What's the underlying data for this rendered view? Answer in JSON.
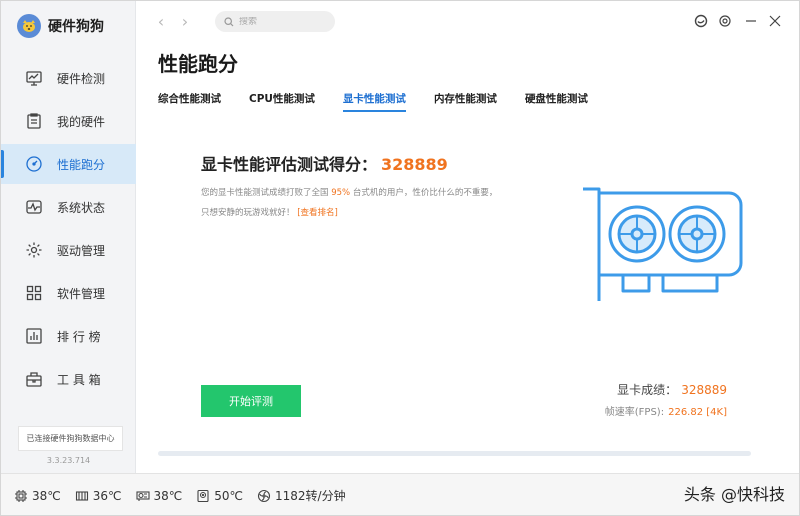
{
  "app": {
    "title": "硬件狗狗"
  },
  "sidebar": {
    "items": [
      {
        "label": "硬件检测",
        "icon": "monitor-chart-icon",
        "active": false
      },
      {
        "label": "我的硬件",
        "icon": "clipboard-list-icon",
        "active": false
      },
      {
        "label": "性能跑分",
        "icon": "speedometer-icon",
        "active": true
      },
      {
        "label": "系统状态",
        "icon": "pulse-monitor-icon",
        "active": false
      },
      {
        "label": "驱动管理",
        "icon": "gear-icon",
        "active": false
      },
      {
        "label": "软件管理",
        "icon": "apps-grid-icon",
        "active": false
      },
      {
        "label": "排 行 榜",
        "icon": "bar-chart-icon",
        "active": false
      },
      {
        "label": "工 具 箱",
        "icon": "toolbox-icon",
        "active": false
      }
    ],
    "connection_status": "已连接硬件狗狗数据中心",
    "version": "3.3.23.714"
  },
  "toolbar": {
    "back_arrow": "‹",
    "forward_arrow": "›",
    "search_placeholder": "搜索"
  },
  "main": {
    "page_title": "性能跑分",
    "tabs": [
      {
        "label": "综合性能测试",
        "active": false
      },
      {
        "label": "CPU性能测试",
        "active": false
      },
      {
        "label": "显卡性能测试",
        "active": true
      },
      {
        "label": "内存性能测试",
        "active": false
      },
      {
        "label": "硬盘性能测试",
        "active": false
      }
    ],
    "score_label": "显卡性能评估测试得分：",
    "score_value": "328889",
    "desc_before": "您的显卡性能测试成绩打败了全国 ",
    "desc_percent": "95%",
    "desc_after": " 台式机的用户，性价比什么的不重要，只想安静的玩游戏就好！",
    "desc_link": "[查看排名]",
    "start_button": "开始评测",
    "result_label": "显卡成绩：",
    "result_value": "328889",
    "fps_label": "帧速率(FPS):",
    "fps_value": "226.82 [4K]"
  },
  "statusbar": {
    "items": [
      {
        "icon": "cpu-chip-icon",
        "value": "38℃"
      },
      {
        "icon": "memory-chip-icon",
        "value": "36℃"
      },
      {
        "icon": "gpu-card-icon",
        "value": "38℃"
      },
      {
        "icon": "hard-disk-icon",
        "value": "50℃"
      },
      {
        "icon": "fan-icon",
        "value": "1182转/分钟"
      }
    ]
  },
  "watermark": "头条 @快科技",
  "colors": {
    "accent": "#2a84de",
    "score": "#f0731f",
    "start_button": "#23c66d",
    "gpu_art": "#3d9be9"
  }
}
